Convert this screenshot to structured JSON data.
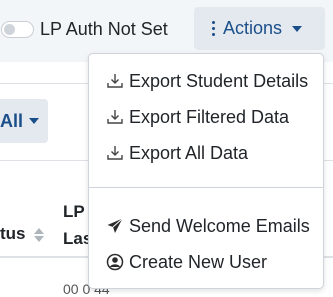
{
  "toggle": {
    "label": "LP Auth Not Set",
    "checked": false
  },
  "actions": {
    "label": "Actions",
    "items": [
      {
        "label": "Export Student Details",
        "icon": "download-icon"
      },
      {
        "label": "Export Filtered Data",
        "icon": "download-icon"
      },
      {
        "label": "Export All Data",
        "icon": "download-icon"
      },
      {
        "label": "Send Welcome Emails",
        "icon": "paper-plane-icon"
      },
      {
        "label": "Create New User",
        "icon": "user-circle-icon"
      }
    ]
  },
  "filter": {
    "label": "All"
  },
  "table": {
    "headers": {
      "status": "tus",
      "lp_line1": "LP",
      "lp_line2": "Las"
    },
    "first_row_value": "00 0 44"
  },
  "colors": {
    "accent": "#1b4f8a",
    "toolbar_bg": "#f3f6f9",
    "button_bg": "#e4e9ef"
  }
}
